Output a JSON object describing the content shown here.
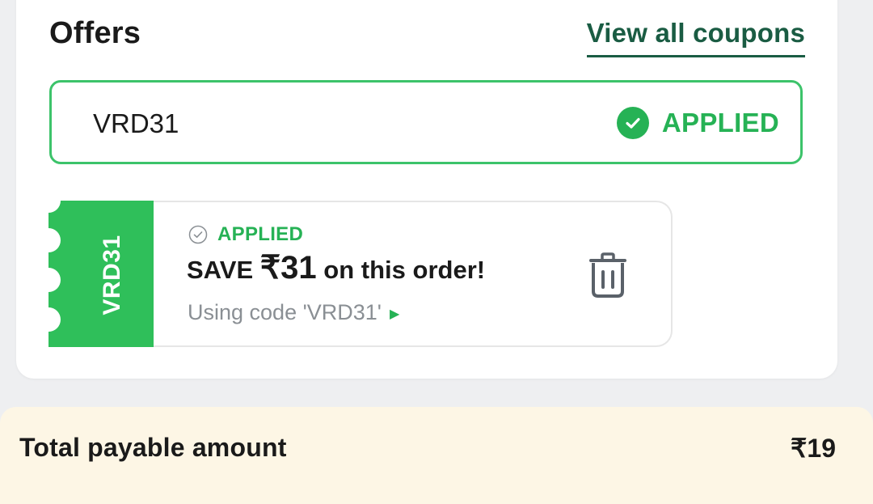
{
  "offers": {
    "title": "Offers",
    "view_all_label": "View all coupons"
  },
  "coupon_input": {
    "value": "VRD31",
    "status": "APPLIED"
  },
  "applied_coupon": {
    "stub_code": "VRD31",
    "status": "APPLIED",
    "save_prefix": "SAVE ",
    "save_amount": "₹31",
    "save_suffix": " on this order!",
    "using_code": "Using code 'VRD31'"
  },
  "footer": {
    "total_label": "Total payable amount",
    "total_amount": "₹19"
  },
  "colors": {
    "accent_green": "#26b255",
    "border_green": "#3cc36a",
    "link_dark_green": "#1a5c43",
    "footer_bg": "#fdf6e5"
  },
  "icons": [
    "check-circle-icon",
    "check-outline-icon",
    "play-arrow-icon",
    "trash-icon"
  ]
}
